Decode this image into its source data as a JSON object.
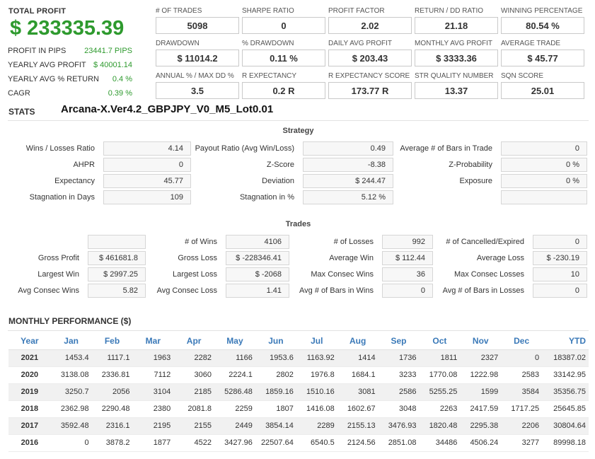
{
  "summary": {
    "total_profit_label": "TOTAL PROFIT",
    "total_profit_value": "$ 233335.39",
    "rows": [
      {
        "label": "PROFIT IN PIPS",
        "value": "23441.7 PIPS"
      },
      {
        "label": "YEARLY AVG PROFIT",
        "value": "$ 40001.14"
      },
      {
        "label": "YEARLY AVG % RETURN",
        "value": "0.4 %"
      },
      {
        "label": "CAGR",
        "value": "0.39 %"
      }
    ]
  },
  "metrics": [
    {
      "label": "# OF TRADES",
      "value": "5098"
    },
    {
      "label": "SHARPE RATIO",
      "value": "0"
    },
    {
      "label": "PROFIT FACTOR",
      "value": "2.02"
    },
    {
      "label": "RETURN / DD RATIO",
      "value": "21.18"
    },
    {
      "label": "WINNING PERCENTAGE",
      "value": "80.54 %"
    },
    {
      "label": "DRAWDOWN",
      "value": "$ 11014.2"
    },
    {
      "label": "% DRAWDOWN",
      "value": "0.11 %"
    },
    {
      "label": "DAILY AVG PROFIT",
      "value": "$ 203.43"
    },
    {
      "label": "MONTHLY AVG PROFIT",
      "value": "$ 3333.36"
    },
    {
      "label": "AVERAGE TRADE",
      "value": "$ 45.77"
    },
    {
      "label": "ANNUAL % / MAX DD %",
      "value": "3.5"
    },
    {
      "label": "R EXPECTANCY",
      "value": "0.2 R"
    },
    {
      "label": "R EXPECTANCY SCORE",
      "value": "173.77 R"
    },
    {
      "label": "STR QUALITY NUMBER",
      "value": "13.37"
    },
    {
      "label": "SQN SCORE",
      "value": "25.01"
    }
  ],
  "stats": {
    "label": "STATS",
    "strategy_name": "Arcana-X.Ver4.2_GBPJPY_V0_M5_Lot0.01"
  },
  "strategy": {
    "title": "Strategy",
    "items": [
      {
        "label": "Wins / Losses Ratio",
        "value": "4.14"
      },
      {
        "label": "Payout Ratio (Avg Win/Loss)",
        "value": "0.49"
      },
      {
        "label": "Average # of Bars in Trade",
        "value": "0"
      },
      {
        "label": "AHPR",
        "value": "0"
      },
      {
        "label": "Z-Score",
        "value": "-8.38"
      },
      {
        "label": "Z-Probability",
        "value": "0 %"
      },
      {
        "label": "Expectancy",
        "value": "45.77"
      },
      {
        "label": "Deviation",
        "value": "$ 244.47"
      },
      {
        "label": "Exposure",
        "value": "0 %"
      },
      {
        "label": "Stagnation in Days",
        "value": "109"
      },
      {
        "label": "Stagnation in %",
        "value": "5.12 %"
      },
      {
        "label": "",
        "value": ""
      }
    ]
  },
  "trades": {
    "title": "Trades",
    "items": [
      {
        "label": "",
        "value": ""
      },
      {
        "label": "# of Wins",
        "value": "4106"
      },
      {
        "label": "# of Losses",
        "value": "992"
      },
      {
        "label": "# of Cancelled/Expired",
        "value": "0"
      },
      {
        "label": "Gross Profit",
        "value": "$ 461681.8"
      },
      {
        "label": "Gross Loss",
        "value": "$ -228346.41"
      },
      {
        "label": "Average Win",
        "value": "$ 112.44"
      },
      {
        "label": "Average Loss",
        "value": "$ -230.19"
      },
      {
        "label": "Largest Win",
        "value": "$ 2997.25"
      },
      {
        "label": "Largest Loss",
        "value": "$ -2068"
      },
      {
        "label": "Max Consec Wins",
        "value": "36"
      },
      {
        "label": "Max Consec Losses",
        "value": "10"
      },
      {
        "label": "Avg Consec Wins",
        "value": "5.82"
      },
      {
        "label": "Avg Consec Loss",
        "value": "1.41"
      },
      {
        "label": "Avg # of Bars in Wins",
        "value": "0"
      },
      {
        "label": "Avg # of Bars in Losses",
        "value": "0"
      }
    ]
  },
  "monthly": {
    "title": "MONTHLY PERFORMANCE ($)",
    "headers": [
      "Year",
      "Jan",
      "Feb",
      "Mar",
      "Apr",
      "May",
      "Jun",
      "Jul",
      "Aug",
      "Sep",
      "Oct",
      "Nov",
      "Dec",
      "YTD"
    ],
    "rows": [
      [
        "2021",
        "1453.4",
        "1117.1",
        "1963",
        "2282",
        "1166",
        "1953.6",
        "1163.92",
        "1414",
        "1736",
        "1811",
        "2327",
        "0",
        "18387.02"
      ],
      [
        "2020",
        "3138.08",
        "2336.81",
        "7112",
        "3060",
        "2224.1",
        "2802",
        "1976.8",
        "1684.1",
        "3233",
        "1770.08",
        "1222.98",
        "2583",
        "33142.95"
      ],
      [
        "2019",
        "3250.7",
        "2056",
        "3104",
        "2185",
        "5286.48",
        "1859.16",
        "1510.16",
        "3081",
        "2586",
        "5255.25",
        "1599",
        "3584",
        "35356.75"
      ],
      [
        "2018",
        "2362.98",
        "2290.48",
        "2380",
        "2081.8",
        "2259",
        "1807",
        "1416.08",
        "1602.67",
        "3048",
        "2263",
        "2417.59",
        "1717.25",
        "25645.85"
      ],
      [
        "2017",
        "3592.48",
        "2316.1",
        "2195",
        "2155",
        "2449",
        "3854.14",
        "2289",
        "2155.13",
        "3476.93",
        "1820.48",
        "2295.38",
        "2206",
        "30804.64"
      ],
      [
        "2016",
        "0",
        "3878.2",
        "1877",
        "4522",
        "3427.96",
        "22507.64",
        "6540.5",
        "2124.56",
        "2851.08",
        "34486",
        "4506.24",
        "3277",
        "89998.18"
      ]
    ]
  },
  "colors": {
    "profit_green": "#2e9a2e",
    "header_blue": "#3a79b8"
  }
}
